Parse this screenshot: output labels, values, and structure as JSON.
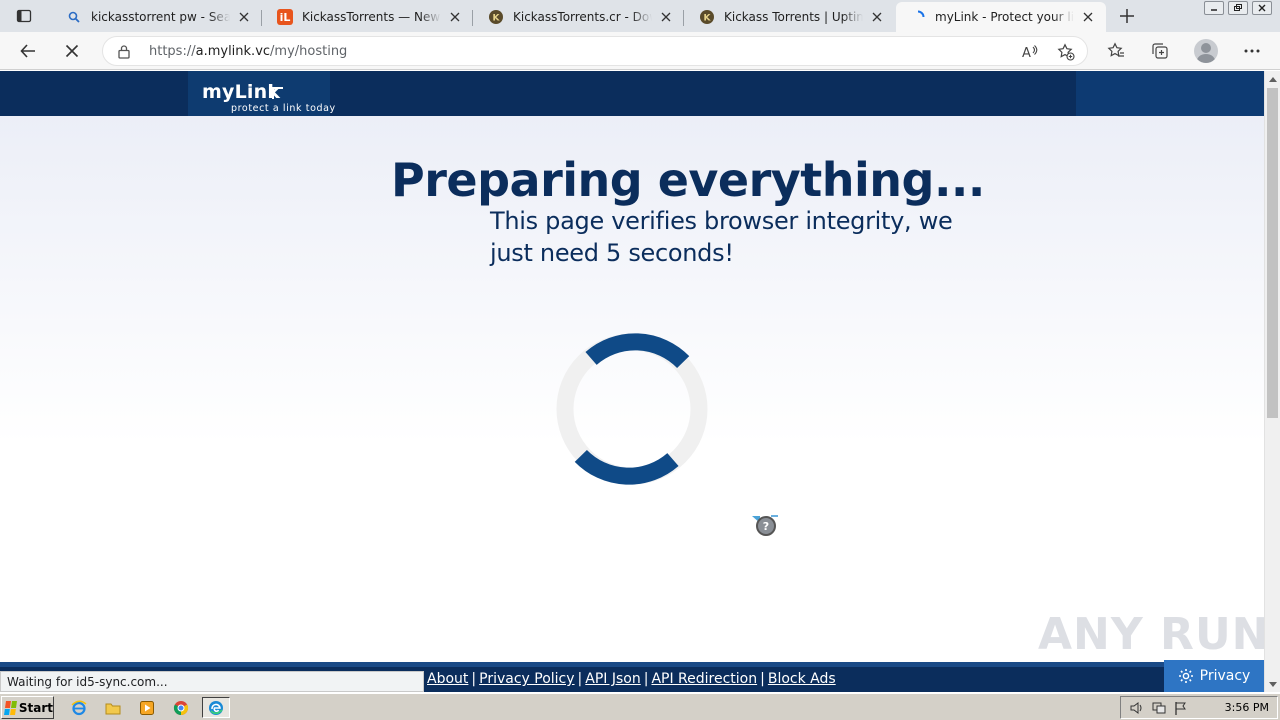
{
  "tabs": [
    {
      "title": "kickasstorrent pw - Search",
      "active": false
    },
    {
      "title": "KickassTorrents — New W",
      "active": false
    },
    {
      "title": "KickassTorrents.cr - Downl",
      "active": false
    },
    {
      "title": "Kickass Torrents | Uptime",
      "active": false
    },
    {
      "title": "myLink - Protect your link",
      "active": true
    }
  ],
  "favicons": {
    "tab2_text": "iL"
  },
  "address_bar": {
    "url_prefix": "https://",
    "url_host": "a.mylink.vc",
    "url_path": "/my/hosting"
  },
  "site": {
    "logo_name": "myLink",
    "logo_tagline": "protect a link today"
  },
  "page": {
    "headline": "Preparing everything...",
    "subline": "This page verifies browser integrity, we just need 5 seconds!"
  },
  "footer": {
    "links": [
      "About",
      "Privacy Policy",
      "API Json",
      "API Redirection",
      "Block Ads"
    ],
    "privacy_label": "Privacy"
  },
  "status_bar": {
    "text": "Waiting for id5-sync.com..."
  },
  "watermark": {
    "text": "ANY RUN"
  },
  "taskbar": {
    "start_label": "Start",
    "clock": "3:56 PM"
  },
  "colors": {
    "brand_navy": "#0b2d5c",
    "spinner_blue": "#0f4a87",
    "privacy_blue": "#2e75c4"
  }
}
